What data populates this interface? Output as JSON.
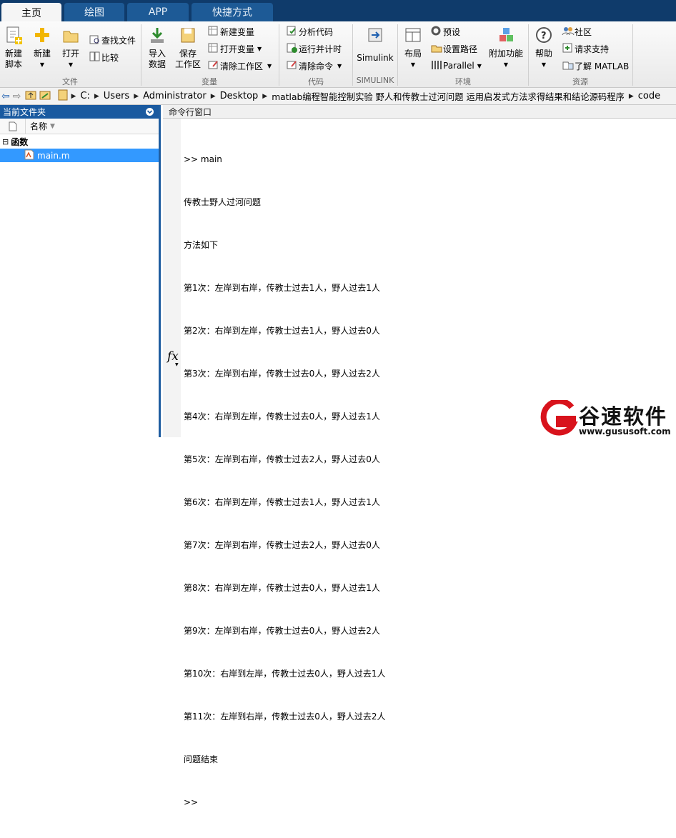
{
  "tabs": [
    "主页",
    "绘图",
    "APP",
    "快捷方式"
  ],
  "ribbon": {
    "file": {
      "new_script": [
        "新建",
        "脚本"
      ],
      "new": "新建",
      "open": "打开",
      "find_files": "查找文件",
      "compare": "比较",
      "group": "文件"
    },
    "variable": {
      "import": [
        "导入",
        "数据"
      ],
      "save": [
        "保存",
        "工作区"
      ],
      "new_var": "新建变量",
      "open_var": "打开变量",
      "clear_ws": "清除工作区",
      "group": "变量"
    },
    "code": {
      "analyze": "分析代码",
      "run_time": "运行并计时",
      "clear_cmd": "清除命令",
      "group": "代码"
    },
    "simulink": {
      "btn": "Simulink",
      "group": "SIMULINK"
    },
    "env": {
      "layout": "布局",
      "prefs": "预设",
      "set_path": "设置路径",
      "parallel": "Parallel",
      "addons": "附加功能",
      "group": "环境"
    },
    "resources": {
      "help": "帮助",
      "community": "社区",
      "support": "请求支持",
      "learn": "了解 MATLAB",
      "group": "资源"
    }
  },
  "address": [
    "C:",
    "Users",
    "Administrator",
    "Desktop",
    "matlab编程智能控制实验 野人和传教士过河问题 运用启发式方法求得结果和结论源码程序",
    "code"
  ],
  "left_panel": {
    "title": "当前文件夹",
    "col_name": "名称",
    "group": "函数",
    "file": "main.m"
  },
  "console": {
    "title": "命令行窗口",
    "lines": [
      ">> main",
      "传教士野人过河问题",
      "方法如下",
      "第1次：左岸到右岸，传教士过去1人，野人过去1人",
      "第2次：右岸到左岸，传教士过去1人，野人过去0人",
      "第3次：左岸到右岸，传教士过去0人，野人过去2人",
      "第4次：右岸到左岸，传教士过去0人，野人过去1人",
      "第5次：左岸到右岸，传教士过去2人，野人过去0人",
      "第6次：右岸到左岸，传教士过去1人，野人过去1人",
      "第7次：左岸到右岸，传教士过去2人，野人过去0人",
      "第8次：右岸到左岸，传教士过去0人，野人过去1人",
      "第9次：左岸到右岸，传教士过去0人，野人过去2人",
      "第10次：右岸到左岸，传教士过去0人，野人过去1人",
      "第11次：左岸到右岸，传教士过去0人，野人过去2人",
      "问题结束",
      ">>"
    ],
    "fx": "fx"
  },
  "watermark": {
    "name": "谷速软件",
    "url": "www.gususoft.com"
  }
}
